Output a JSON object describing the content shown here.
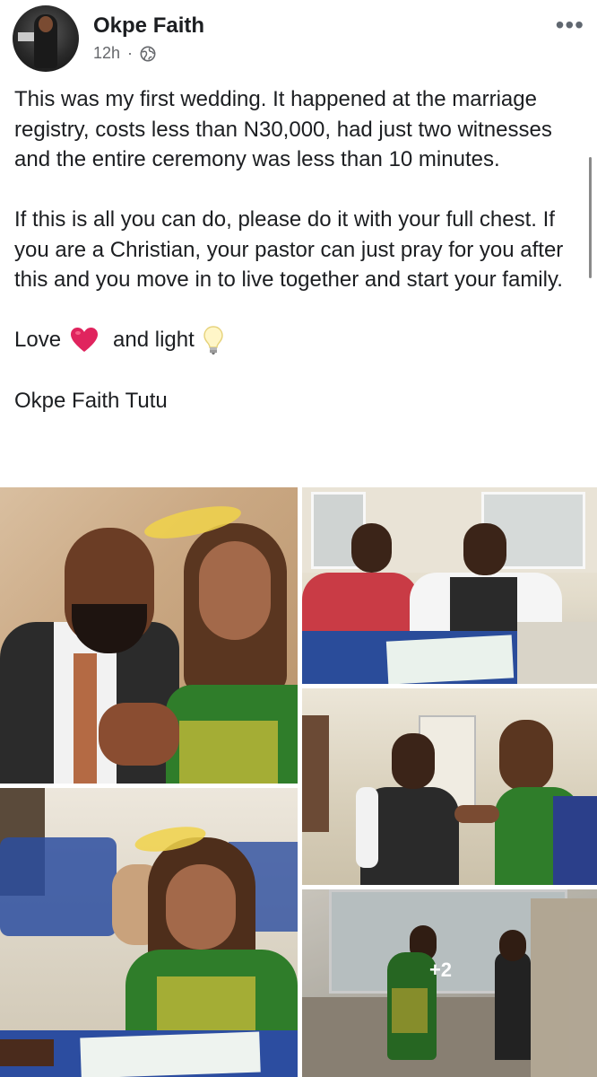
{
  "post": {
    "author": "Okpe Faith",
    "time": "12h",
    "separator": "·",
    "privacy_icon": "globe-icon",
    "more_icon": "more-options-icon",
    "more_label": "•••",
    "paragraphs": [
      "This was my first wedding. It happened at the marriage registry, costs less than N30,000, had just two witnesses and the entire ceremony was less than 10 minutes.",
      "If this is all you can do, please do it with your full chest. If you are a Christian,  your pastor can just pray for you after this and you move in to live together and start your family."
    ],
    "love_prefix": "Love",
    "love_middle": "and light",
    "heart_icon": "red-heart-emoji",
    "bulb_icon": "light-bulb-emoji",
    "signature": "Okpe Faith Tutu"
  },
  "gallery": {
    "photos": [
      {
        "name": "couple-portrait"
      },
      {
        "name": "groom-signing-register"
      },
      {
        "name": "ring-exchange"
      },
      {
        "name": "bride-signing-register"
      },
      {
        "name": "couple-on-stairs"
      }
    ],
    "more_count_label": "+2"
  },
  "colors": {
    "text": "#1c1e21",
    "secondary": "#65676b",
    "heart": "#e0245e"
  }
}
